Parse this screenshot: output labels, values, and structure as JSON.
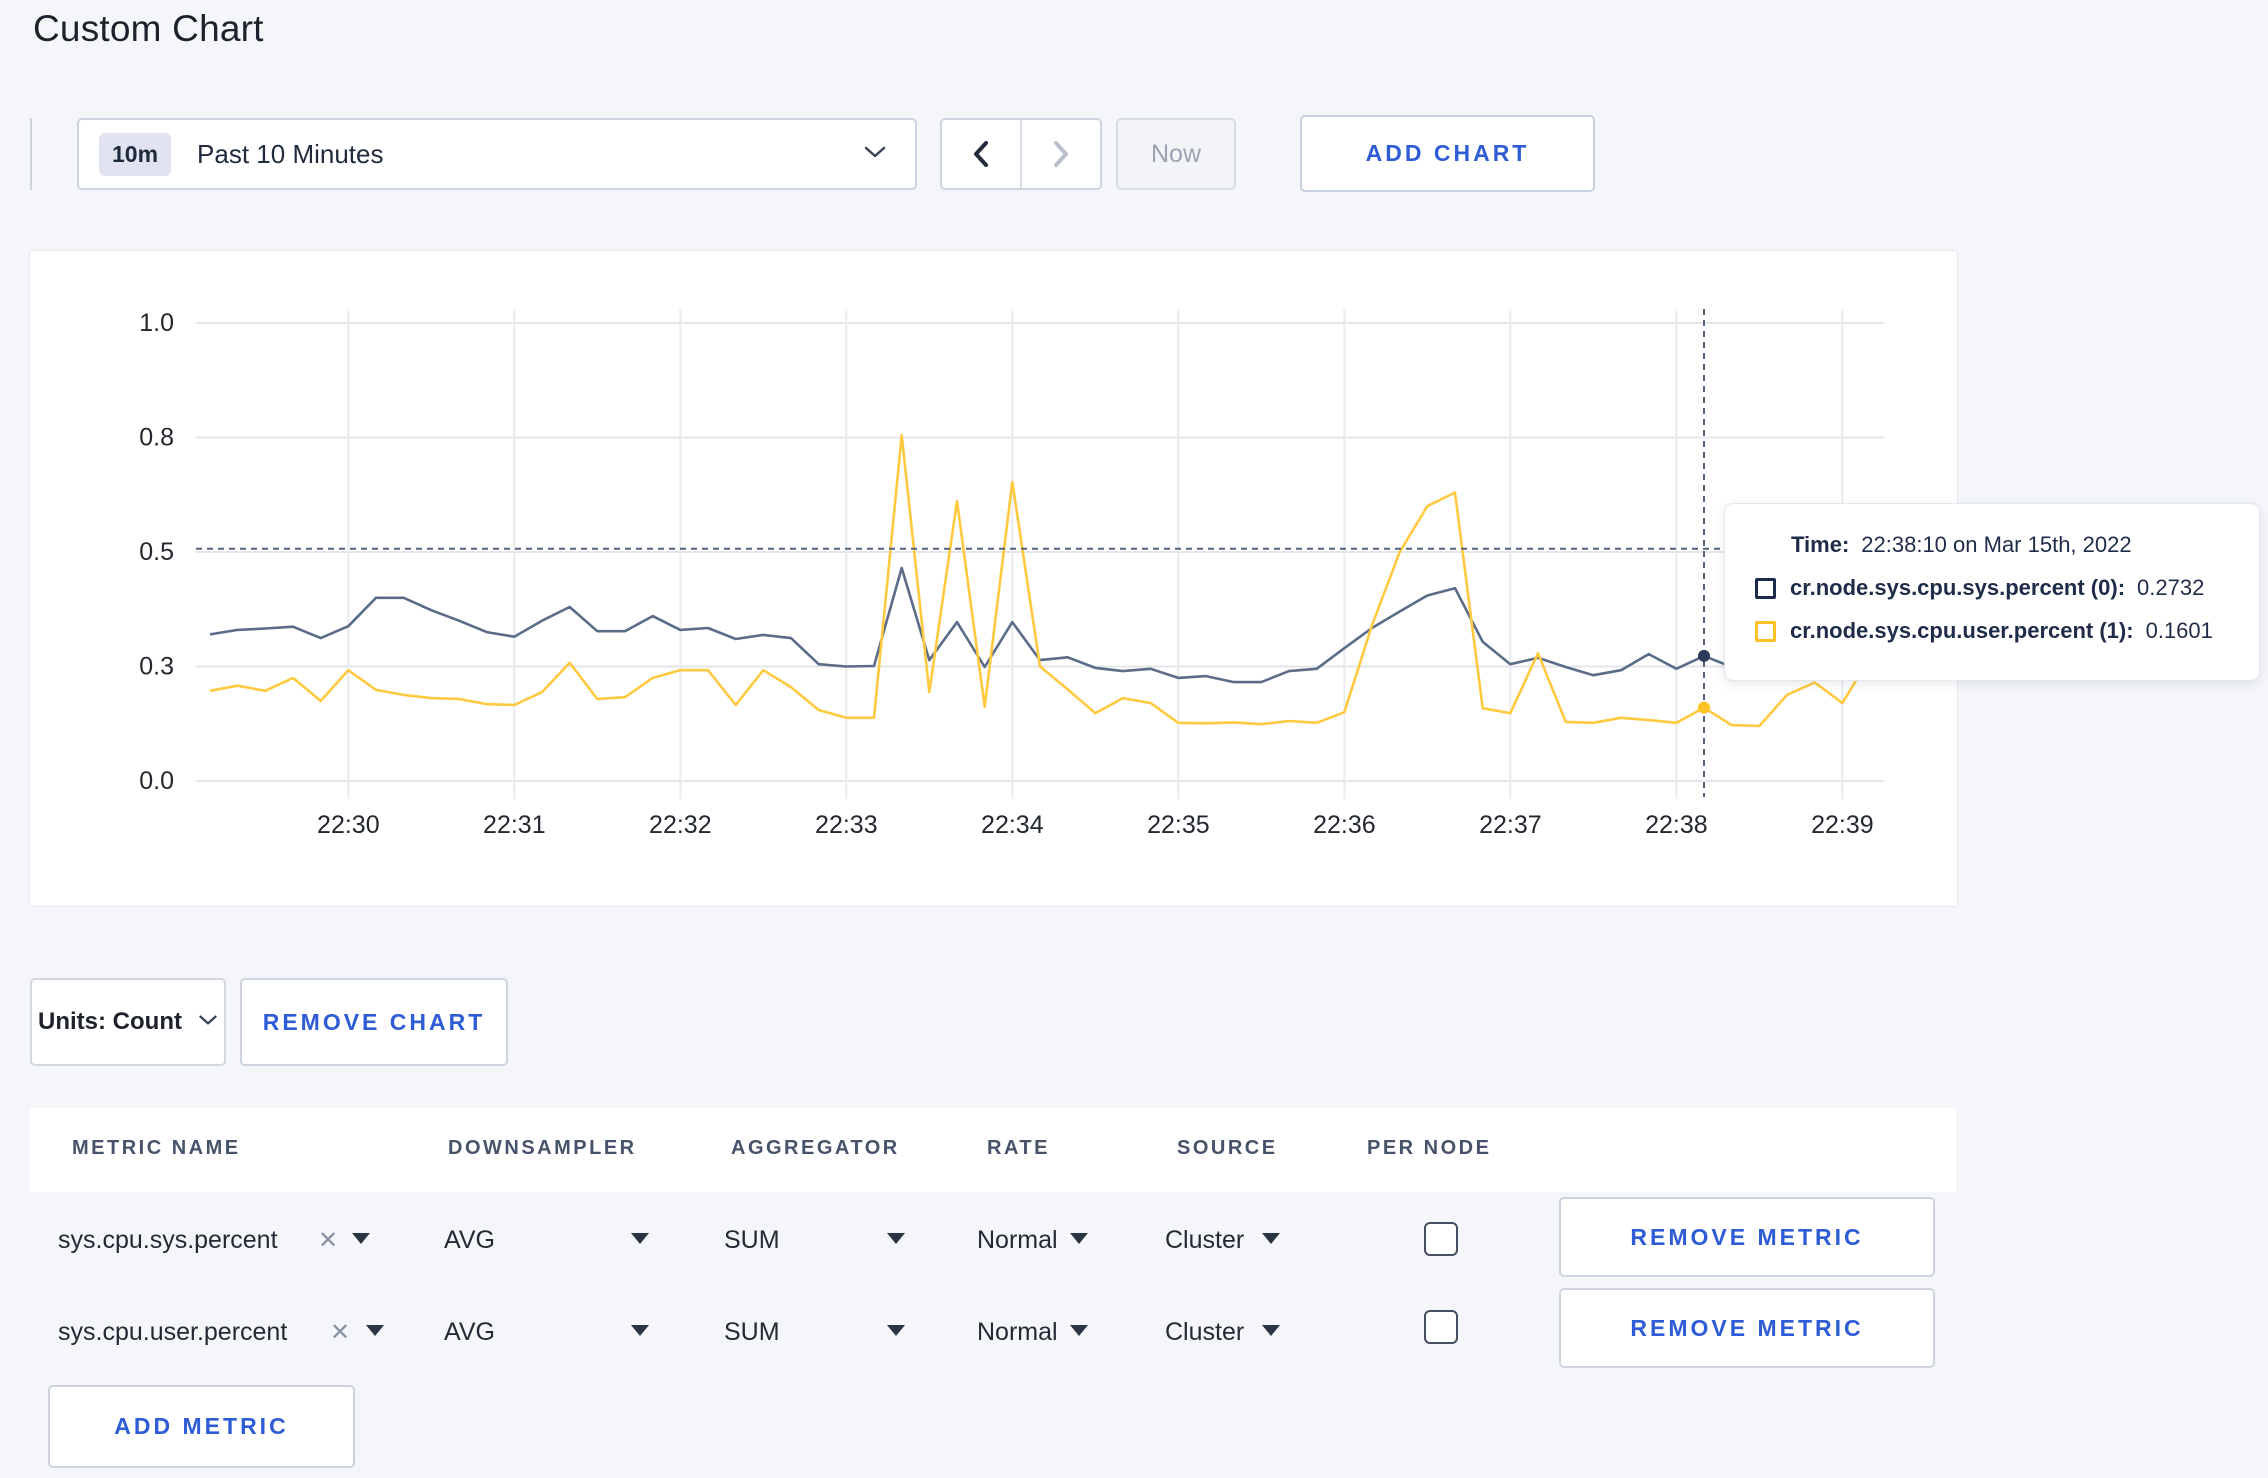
{
  "page": {
    "title": "Custom Chart"
  },
  "toolbar": {
    "range_badge": "10m",
    "range_label": "Past 10 Minutes",
    "now_label": "Now",
    "add_chart_label": "ADD CHART"
  },
  "chart_data": {
    "type": "line",
    "title": "",
    "xlabel": "",
    "ylabel": "",
    "start_time": "22:29:10",
    "interval_seconds": 10,
    "grid": true,
    "legend_position": "tooltip",
    "ylim": [
      0,
      1.0
    ],
    "y_ticks": [
      {
        "v": 0.0,
        "label": "0.0"
      },
      {
        "v": 0.25,
        "label": "0.3"
      },
      {
        "v": 0.5,
        "label": "0.5"
      },
      {
        "v": 0.75,
        "label": "0.8"
      },
      {
        "v": 1.0,
        "label": "1.0"
      }
    ],
    "x_ticks": [
      {
        "index": 5,
        "label": "22:30"
      },
      {
        "index": 11,
        "label": "22:31"
      },
      {
        "index": 17,
        "label": "22:32"
      },
      {
        "index": 23,
        "label": "22:33"
      },
      {
        "index": 29,
        "label": "22:34"
      },
      {
        "index": 35,
        "label": "22:35"
      },
      {
        "index": 41,
        "label": "22:36"
      },
      {
        "index": 47,
        "label": "22:37"
      },
      {
        "index": 53,
        "label": "22:38"
      },
      {
        "index": 59,
        "label": "22:39"
      }
    ],
    "series": [
      {
        "name": "cr.node.sys.cpu.sys.percent (0):",
        "line_color": "#5B6C88",
        "swatch_color": "#1C2B4A",
        "values": [
          0.32,
          0.33,
          0.333,
          0.337,
          0.312,
          0.338,
          0.4,
          0.4,
          0.373,
          0.35,
          0.325,
          0.315,
          0.35,
          0.38,
          0.327,
          0.327,
          0.36,
          0.33,
          0.334,
          0.31,
          0.319,
          0.312,
          0.255,
          0.25,
          0.251,
          0.465,
          0.264,
          0.347,
          0.249,
          0.347,
          0.264,
          0.27,
          0.247,
          0.24,
          0.245,
          0.225,
          0.229,
          0.216,
          0.216,
          0.24,
          0.245,
          0.29,
          0.334,
          0.37,
          0.405,
          0.421,
          0.304,
          0.255,
          0.269,
          0.249,
          0.231,
          0.242,
          0.277,
          0.245,
          0.2732,
          0.249,
          0.262,
          0.27,
          0.258,
          0.28,
          0.302
        ]
      },
      {
        "name": "cr.node.sys.cpu.user.percent (1):",
        "line_color": "#FFC940",
        "swatch_color": "#FFC224",
        "values": [
          0.197,
          0.208,
          0.197,
          0.225,
          0.175,
          0.242,
          0.199,
          0.188,
          0.181,
          0.179,
          0.168,
          0.166,
          0.194,
          0.258,
          0.179,
          0.183,
          0.225,
          0.242,
          0.242,
          0.166,
          0.242,
          0.205,
          0.155,
          0.138,
          0.138,
          0.755,
          0.194,
          0.611,
          0.162,
          0.653,
          0.25,
          0.2,
          0.148,
          0.181,
          0.17,
          0.127,
          0.126,
          0.128,
          0.124,
          0.131,
          0.127,
          0.15,
          0.34,
          0.5,
          0.6,
          0.63,
          0.159,
          0.148,
          0.279,
          0.129,
          0.127,
          0.138,
          0.133,
          0.127,
          0.1601,
          0.122,
          0.12,
          0.188,
          0.215,
          0.17,
          0.27
        ]
      }
    ],
    "crosshair": {
      "x_index": 54,
      "y_value": 0.507
    }
  },
  "tooltip": {
    "time_label": "Time:",
    "time_value": "22:38:10 on Mar 15th, 2022",
    "rows": [
      {
        "name": "cr.node.sys.cpu.sys.percent (0):",
        "value": "0.2732"
      },
      {
        "name": "cr.node.sys.cpu.user.percent (1):",
        "value": "0.1601"
      }
    ]
  },
  "units_bar": {
    "units_label": "Units: Count",
    "remove_chart_label": "REMOVE CHART"
  },
  "metrics_table": {
    "headers": [
      "METRIC NAME",
      "DOWNSAMPLER",
      "AGGREGATOR",
      "RATE",
      "SOURCE",
      "PER NODE"
    ],
    "rows": [
      {
        "metric": "sys.cpu.sys.percent",
        "downsampler": "AVG",
        "aggregator": "SUM",
        "rate": "Normal",
        "source": "Cluster",
        "per_node_checked": false,
        "remove_label": "REMOVE METRIC"
      },
      {
        "metric": "sys.cpu.user.percent",
        "downsampler": "AVG",
        "aggregator": "SUM",
        "rate": "Normal",
        "source": "Cluster",
        "per_node_checked": false,
        "remove_label": "REMOVE METRIC"
      }
    ],
    "add_metric_label": "ADD METRIC"
  }
}
